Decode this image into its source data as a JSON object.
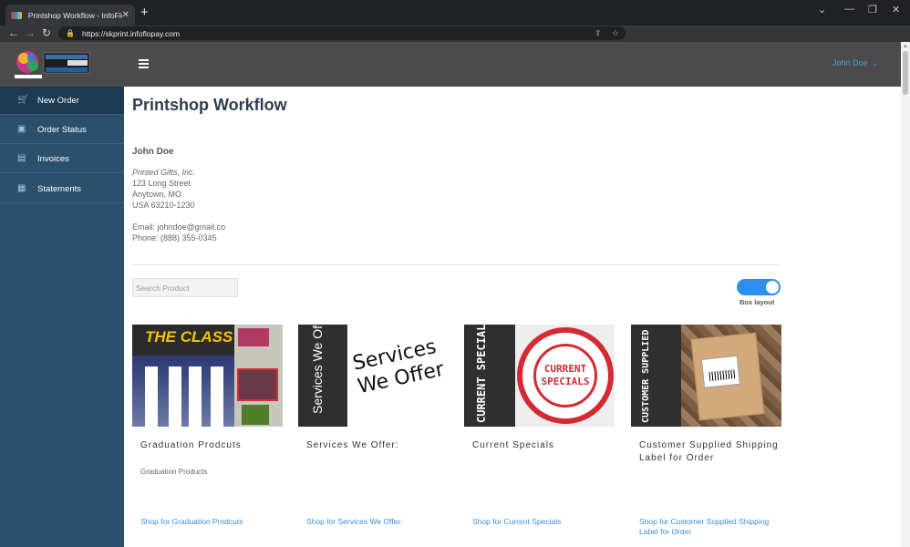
{
  "browser": {
    "tab_title": "Printshop Workflow - InfoFlo Pay",
    "url": "https://skprint.infoflopay.com"
  },
  "header": {
    "user_name": "John Doe"
  },
  "sidebar": {
    "items": [
      {
        "label": "New Order",
        "icon": "cart-icon",
        "active": true
      },
      {
        "label": "Order Status",
        "icon": "bag-icon",
        "active": false
      },
      {
        "label": "Invoices",
        "icon": "money-icon",
        "active": false
      },
      {
        "label": "Statements",
        "icon": "document-icon",
        "active": false
      }
    ]
  },
  "main": {
    "title": "Printshop Workflow",
    "customer": {
      "name": "John Doe",
      "company": "Printed Gifts, Inc.",
      "street": "123 Long Street",
      "city": "Anytown, MO",
      "country_zip": "USA 63210-1230",
      "email": "Email: johndoe@gmail.co",
      "phone": "Phone: (888) 355-0345"
    },
    "search": {
      "placeholder": "Search Product"
    },
    "layout_toggle": {
      "label": "Box layout",
      "on": true
    },
    "products": [
      {
        "title": "Graduation Prodcuts",
        "desc": "Graduation Products",
        "link": "Shop for Graduation Prodcuts",
        "thumb_text": "THE CLASS"
      },
      {
        "title": "Services We Offer:",
        "desc": "",
        "link": "Shop for Services We Offer:",
        "thumb_text": "Services We Offer"
      },
      {
        "title": "Current Specials",
        "desc": "",
        "link": "Shop for Current Specials",
        "thumb_text": "CURRENT SPECIALS"
      },
      {
        "title": "Customer Supplied Shipping Label for Order",
        "desc": "",
        "link": "Shop for Customer Supplied Shipping Label for Order",
        "thumb_text": "CUSTOMER SUPPLIED SHIPPING LABEL"
      }
    ]
  },
  "colors": {
    "sidebar": "#2b506c",
    "header": "#4b4b4b",
    "accent": "#3a8dd8",
    "toggle": "#2c8ff0"
  }
}
